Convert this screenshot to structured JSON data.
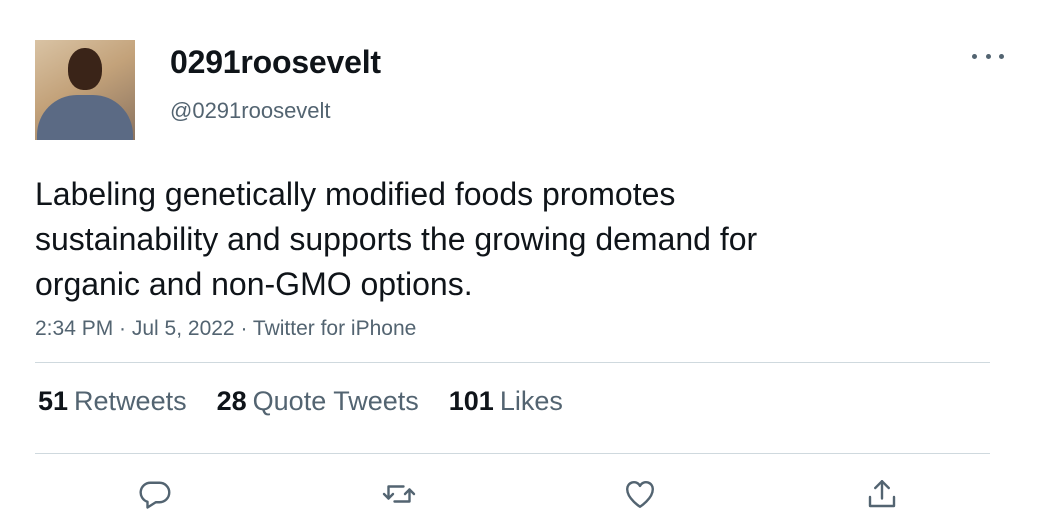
{
  "author": {
    "display_name": "0291roosevelt",
    "handle": "@0291roosevelt"
  },
  "tweet": {
    "lines": [
      "Labeling genetically modified foods promotes",
      "sustainability and supports the growing demand for",
      "organic and non-GMO options."
    ],
    "meta": "2:34 PM · Jul 5, 2022 · Twitter for iPhone"
  },
  "stats": {
    "retweets": {
      "count": "51",
      "label": "Retweets"
    },
    "quotes": {
      "count": "28",
      "label": "Quote Tweets"
    },
    "likes": {
      "count": "101",
      "label": "Likes"
    }
  },
  "icons": {
    "more": "more-icon",
    "reply": "reply-icon",
    "retweet": "retweet-icon",
    "like": "like-icon",
    "share": "share-icon"
  },
  "colors": {
    "text_primary": "#0f1419",
    "text_secondary": "#536471",
    "divider": "#cfd9de"
  }
}
